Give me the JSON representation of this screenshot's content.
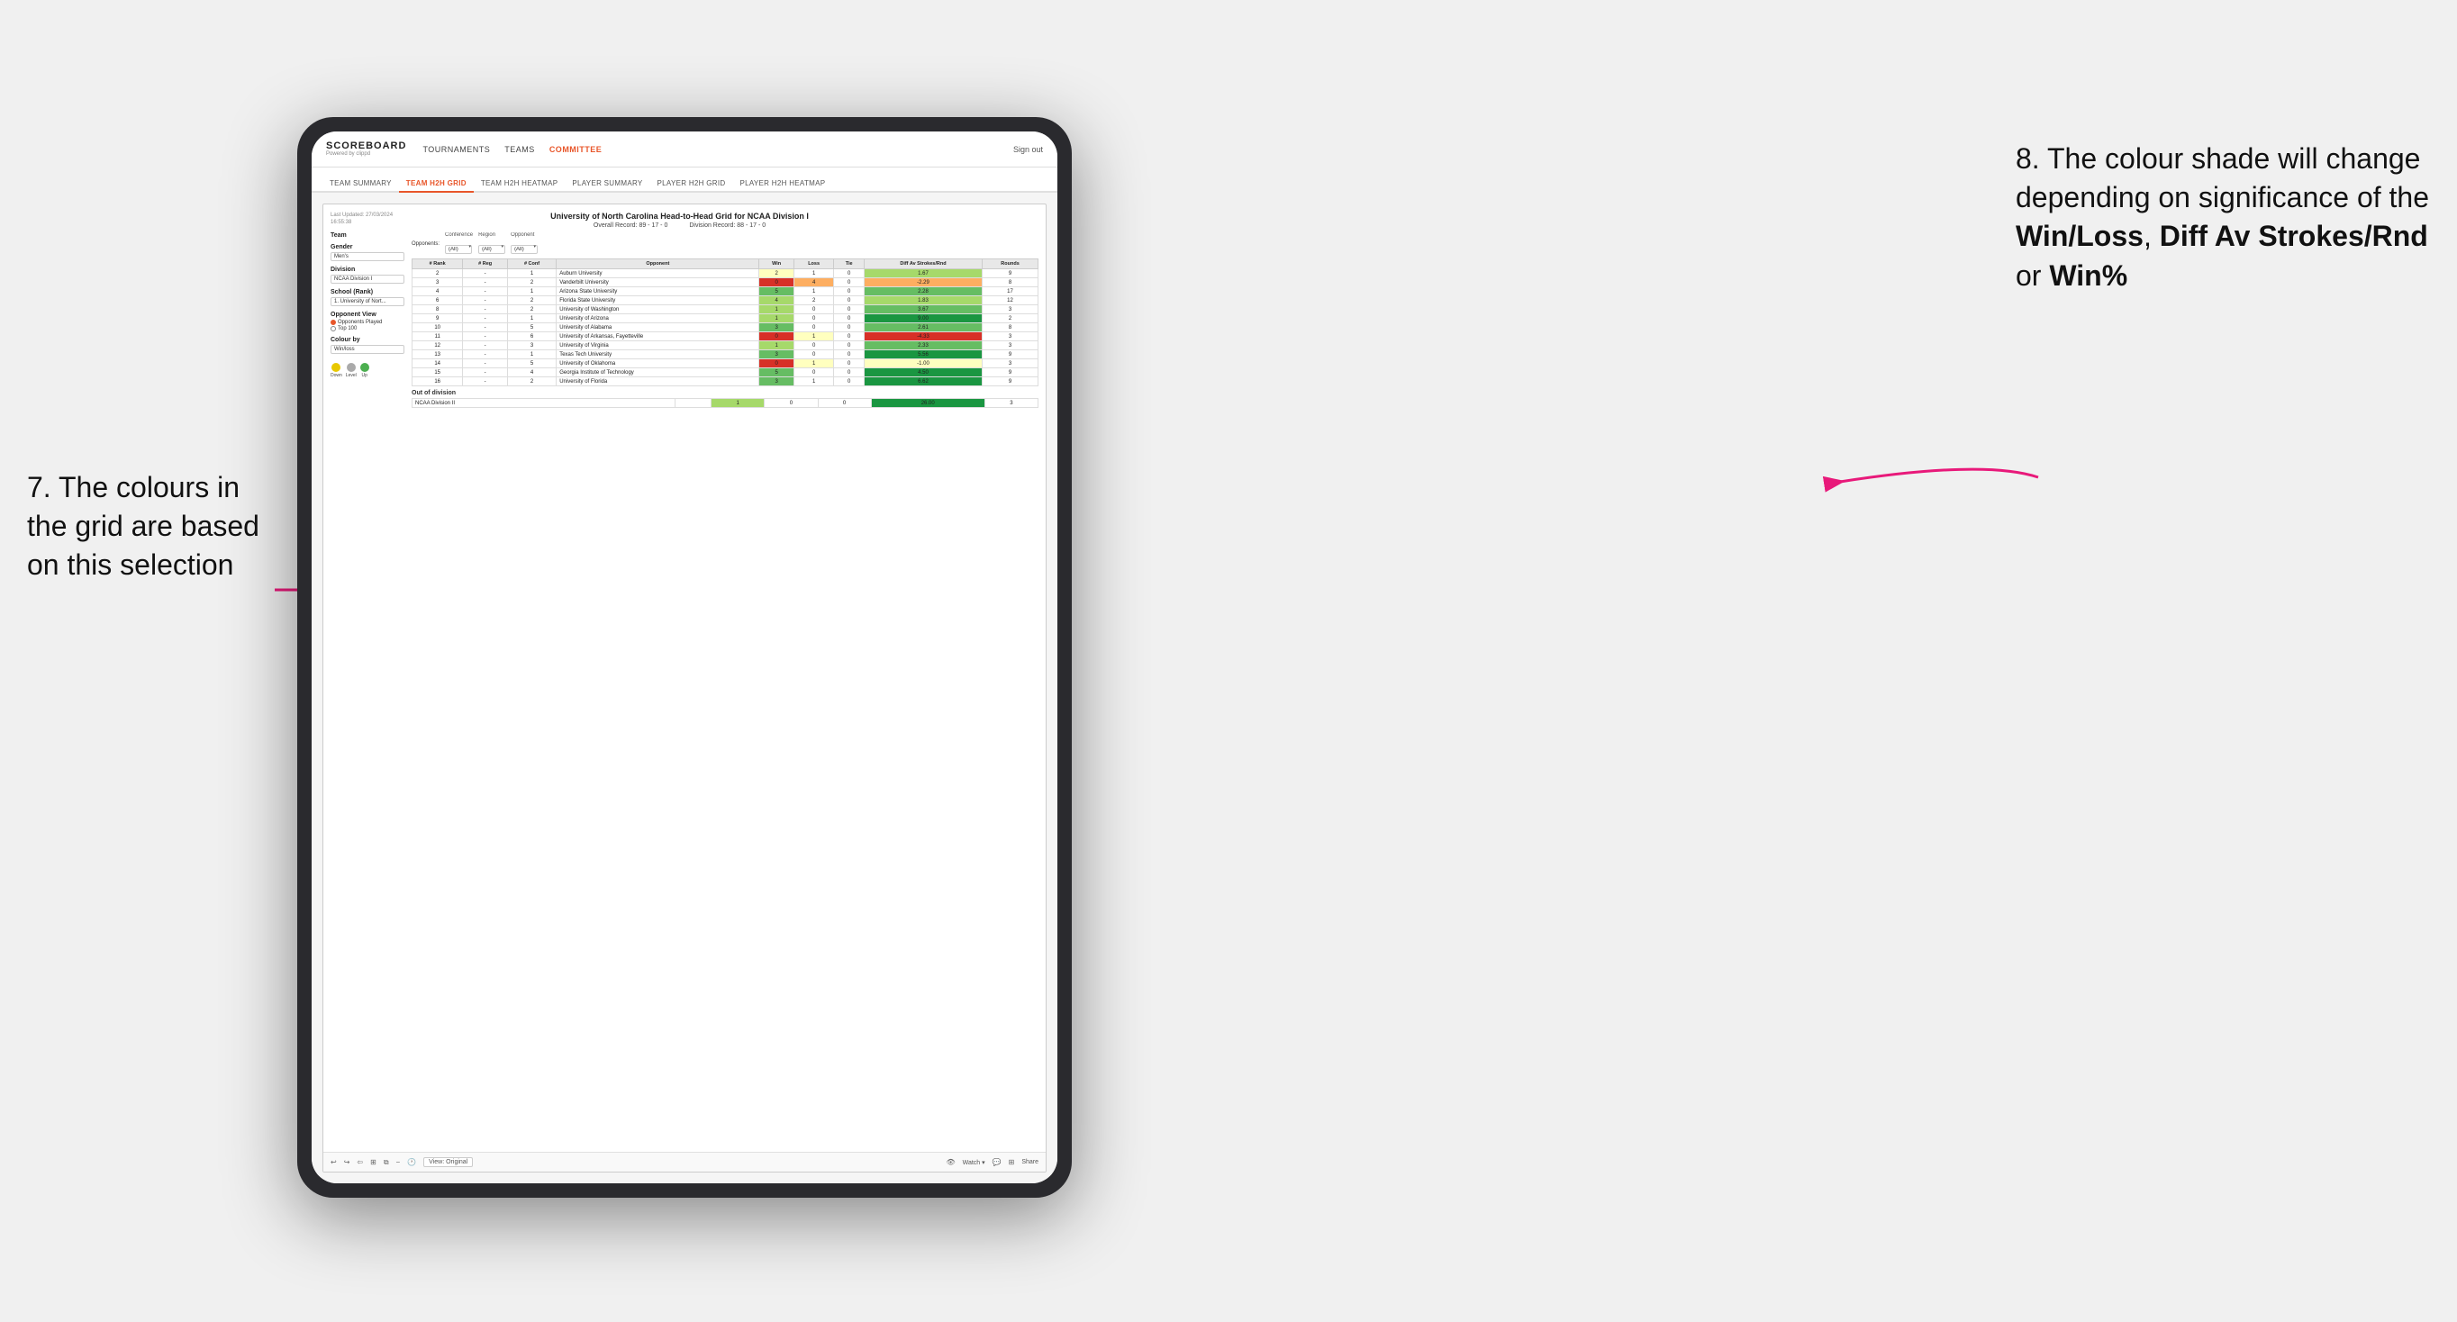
{
  "annotations": {
    "left": {
      "text": "7. The colours in the grid are based on this selection"
    },
    "right": {
      "text": "8. The colour shade will change depending on significance of the ",
      "bold1": "Win/Loss",
      "comma1": ", ",
      "bold2": "Diff Av Strokes/Rnd",
      "or": " or ",
      "bold3": "Win%"
    }
  },
  "nav": {
    "logo_title": "SCOREBOARD",
    "logo_sub": "Powered by clippd",
    "links": [
      "TOURNAMENTS",
      "TEAMS",
      "COMMITTEE"
    ],
    "sign_out": "Sign out"
  },
  "sub_tabs": [
    {
      "label": "TEAM SUMMARY",
      "active": false
    },
    {
      "label": "TEAM H2H GRID",
      "active": true
    },
    {
      "label": "TEAM H2H HEATMAP",
      "active": false
    },
    {
      "label": "PLAYER SUMMARY",
      "active": false
    },
    {
      "label": "PLAYER H2H GRID",
      "active": false
    },
    {
      "label": "PLAYER H2H HEATMAP",
      "active": false
    }
  ],
  "tableau": {
    "last_updated_label": "Last Updated: 27/03/2024",
    "last_updated_time": "16:55:38",
    "title": "University of North Carolina Head-to-Head Grid for NCAA Division I",
    "overall_record": "Overall Record: 89 - 17 - 0",
    "division_record": "Division Record: 88 - 17 - 0",
    "left_panel": {
      "team_label": "Team",
      "gender_label": "Gender",
      "gender_value": "Men's",
      "division_label": "Division",
      "division_value": "NCAA Division I",
      "school_label": "School (Rank)",
      "school_value": "1. University of Nort...",
      "opponent_view_label": "Opponent View",
      "opponent_view_options": [
        "Opponents Played",
        "Top 100"
      ],
      "opponent_view_selected": "Opponents Played",
      "colour_by_label": "Colour by",
      "colour_by_value": "Win/loss",
      "legend": [
        {
          "color": "#e8c800",
          "label": "Down"
        },
        {
          "color": "#aaa",
          "label": "Level"
        },
        {
          "color": "#4caf50",
          "label": "Up"
        }
      ]
    },
    "filter_row": {
      "conference_label": "Conference",
      "conference_value": "(All)",
      "region_label": "Region",
      "region_value": "(All)",
      "opponent_label": "Opponent",
      "opponent_value": "(All)",
      "opponents_label": "Opponents:"
    },
    "grid_headers": [
      "# Rank",
      "# Reg",
      "# Conf",
      "Opponent",
      "Win",
      "Loss",
      "Tie",
      "Diff Av Strokes/Rnd",
      "Rounds"
    ],
    "grid_rows": [
      {
        "rank": "2",
        "reg": "-",
        "conf": "1",
        "opponent": "Auburn University",
        "win": "2",
        "loss": "1",
        "tie": "0",
        "diff": "1.67",
        "rounds": "9",
        "win_color": "cell-yellow",
        "loss_color": "cell-neutral",
        "diff_color": "cell-green-light"
      },
      {
        "rank": "3",
        "reg": "-",
        "conf": "2",
        "opponent": "Vanderbilt University",
        "win": "0",
        "loss": "4",
        "tie": "0",
        "diff": "-2.29",
        "rounds": "8",
        "win_color": "cell-red",
        "loss_color": "cell-orange-light",
        "diff_color": "cell-orange-light"
      },
      {
        "rank": "4",
        "reg": "-",
        "conf": "1",
        "opponent": "Arizona State University",
        "win": "5",
        "loss": "1",
        "tie": "0",
        "diff": "2.28",
        "rounds": "17",
        "win_color": "cell-green-med",
        "loss_color": "cell-neutral",
        "diff_color": "cell-green-med"
      },
      {
        "rank": "6",
        "reg": "-",
        "conf": "2",
        "opponent": "Florida State University",
        "win": "4",
        "loss": "2",
        "tie": "0",
        "diff": "1.83",
        "rounds": "12",
        "win_color": "cell-green-light",
        "loss_color": "cell-neutral",
        "diff_color": "cell-green-light"
      },
      {
        "rank": "8",
        "reg": "-",
        "conf": "2",
        "opponent": "University of Washington",
        "win": "1",
        "loss": "0",
        "tie": "0",
        "diff": "3.67",
        "rounds": "3",
        "win_color": "cell-green-light",
        "loss_color": "cell-neutral",
        "diff_color": "cell-green-med"
      },
      {
        "rank": "9",
        "reg": "-",
        "conf": "1",
        "opponent": "University of Arizona",
        "win": "1",
        "loss": "0",
        "tie": "0",
        "diff": "9.00",
        "rounds": "2",
        "win_color": "cell-green-light",
        "loss_color": "cell-neutral",
        "diff_color": "cell-green-dark"
      },
      {
        "rank": "10",
        "reg": "-",
        "conf": "5",
        "opponent": "University of Alabama",
        "win": "3",
        "loss": "0",
        "tie": "0",
        "diff": "2.61",
        "rounds": "8",
        "win_color": "cell-green-med",
        "loss_color": "cell-neutral",
        "diff_color": "cell-green-med"
      },
      {
        "rank": "11",
        "reg": "-",
        "conf": "6",
        "opponent": "University of Arkansas, Fayetteville",
        "win": "0",
        "loss": "1",
        "tie": "0",
        "diff": "-4.33",
        "rounds": "3",
        "win_color": "cell-red",
        "loss_color": "cell-yellow",
        "diff_color": "cell-red"
      },
      {
        "rank": "12",
        "reg": "-",
        "conf": "3",
        "opponent": "University of Virginia",
        "win": "1",
        "loss": "0",
        "tie": "0",
        "diff": "2.33",
        "rounds": "3",
        "win_color": "cell-green-light",
        "loss_color": "cell-neutral",
        "diff_color": "cell-green-med"
      },
      {
        "rank": "13",
        "reg": "-",
        "conf": "1",
        "opponent": "Texas Tech University",
        "win": "3",
        "loss": "0",
        "tie": "0",
        "diff": "5.56",
        "rounds": "9",
        "win_color": "cell-green-med",
        "loss_color": "cell-neutral",
        "diff_color": "cell-green-dark"
      },
      {
        "rank": "14",
        "reg": "-",
        "conf": "5",
        "opponent": "University of Oklahoma",
        "win": "0",
        "loss": "1",
        "tie": "0",
        "diff": "-1.00",
        "rounds": "3",
        "win_color": "cell-red",
        "loss_color": "cell-yellow",
        "diff_color": "cell-yellow"
      },
      {
        "rank": "15",
        "reg": "-",
        "conf": "4",
        "opponent": "Georgia Institute of Technology",
        "win": "5",
        "loss": "0",
        "tie": "0",
        "diff": "4.50",
        "rounds": "9",
        "win_color": "cell-green-med",
        "loss_color": "cell-neutral",
        "diff_color": "cell-green-dark"
      },
      {
        "rank": "16",
        "reg": "-",
        "conf": "2",
        "opponent": "University of Florida",
        "win": "3",
        "loss": "1",
        "tie": "0",
        "diff": "6.62",
        "rounds": "9",
        "win_color": "cell-green-med",
        "loss_color": "cell-neutral",
        "diff_color": "cell-green-dark"
      }
    ],
    "out_of_division_label": "Out of division",
    "out_of_division_row": {
      "division": "NCAA Division II",
      "win": "1",
      "loss": "0",
      "tie": "0",
      "diff": "26.00",
      "rounds": "3"
    },
    "bottom_bar": {
      "view_original": "View: Original",
      "watch": "Watch ▾",
      "share": "Share"
    }
  }
}
